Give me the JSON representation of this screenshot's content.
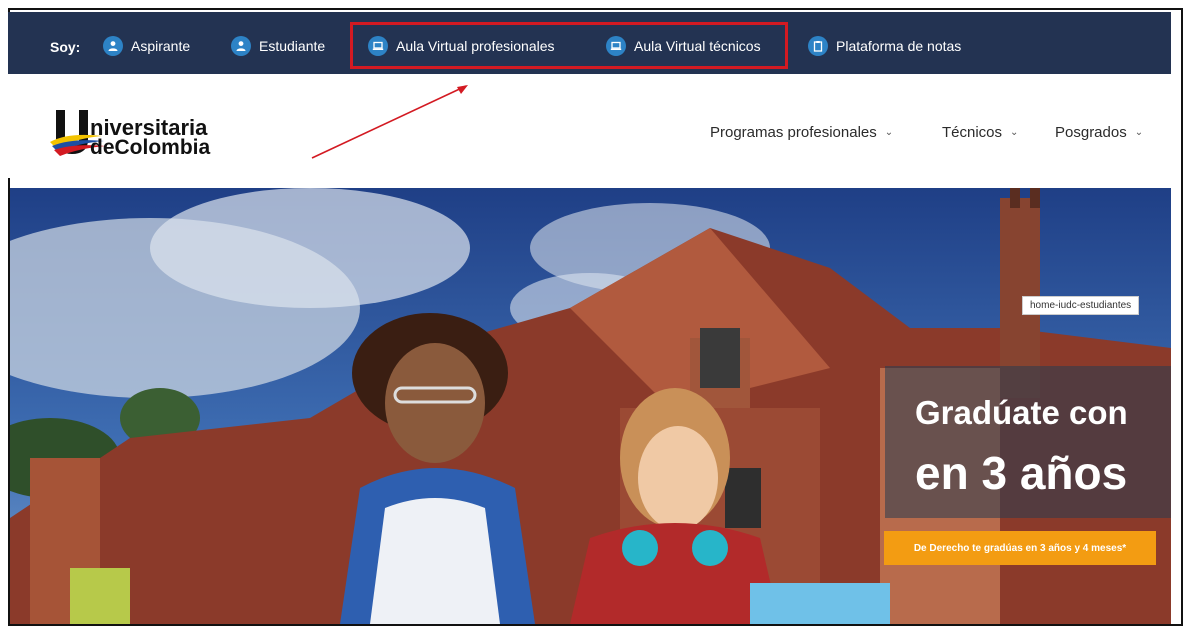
{
  "topbar": {
    "soy_label": "Soy:",
    "items": [
      {
        "label": "Aspirante",
        "icon": "person-icon"
      },
      {
        "label": "Estudiante",
        "icon": "person-icon"
      },
      {
        "label": "Aula Virtual profesionales",
        "icon": "laptop-icon"
      },
      {
        "label": "Aula Virtual técnicos",
        "icon": "laptop-icon"
      },
      {
        "label": "Plataforma de notas",
        "icon": "clipboard-icon"
      }
    ],
    "bg_color": "#233352",
    "icon_color": "#2d83c6",
    "highlight_color": "#d31a22"
  },
  "header": {
    "logo": {
      "line1": "niversitaria",
      "line2": "deColombia"
    },
    "nav": [
      {
        "label": "Programas profesionales"
      },
      {
        "label": "Técnicos"
      },
      {
        "label": "Posgrados"
      }
    ]
  },
  "hero": {
    "tag": "home-iudc-estudiantes",
    "headline_line1": "Gradúate con",
    "headline_line2": "en 3 años",
    "cta": "De Derecho te gradúas en 3 años y 4 meses*",
    "cta_color": "#f39c12"
  }
}
